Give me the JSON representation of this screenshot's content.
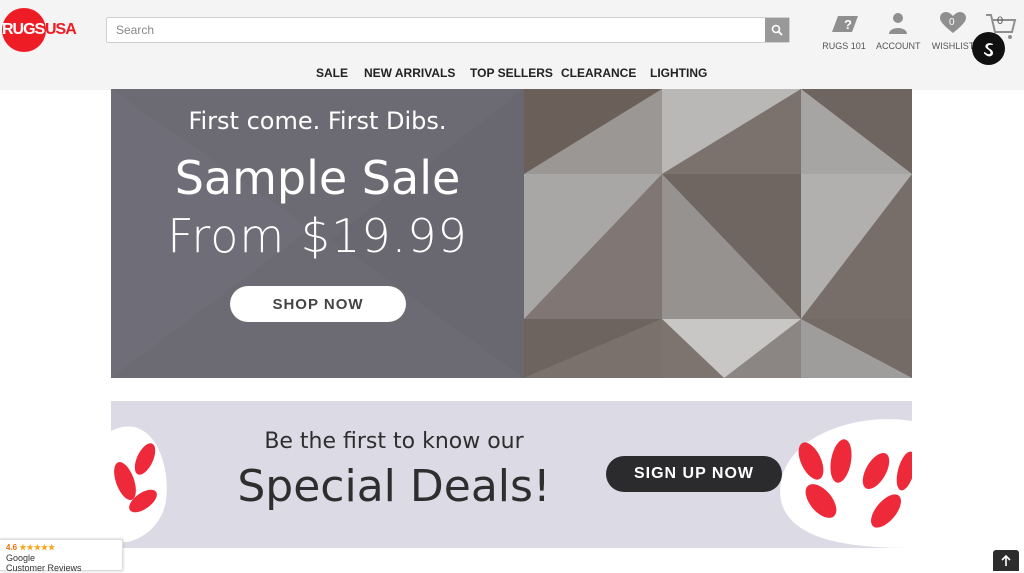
{
  "logo": {
    "part1": "RUGS",
    "part2": "USA"
  },
  "search": {
    "placeholder": "Search"
  },
  "header_icons": {
    "rugs101": "RUGS 101",
    "account": "ACCOUNT",
    "wishlist": "WISHLIST",
    "wishlist_count": "0",
    "cart_count": "0"
  },
  "nav": [
    "SALE",
    "NEW ARRIVALS",
    "TOP SELLERS",
    "CLEARANCE",
    "LIGHTING"
  ],
  "hero": {
    "subtitle": "First come. First Dibs.",
    "title": "Sample Sale",
    "price": "From $19.99",
    "cta": "SHOP NOW"
  },
  "promo": {
    "line1": "Be the first to know our",
    "line2": "Special Deals!",
    "cta": "SIGN UP NOW"
  },
  "reviews": {
    "rating": "4.6",
    "stars": "★★★★★",
    "line1": "Google",
    "line2": "Customer Reviews"
  },
  "colors": {
    "brand_red": "#ee1c25",
    "hero_bg": "#6c6b74",
    "promo_bg": "#dcdae4",
    "dark_button": "#2b2b2d"
  }
}
